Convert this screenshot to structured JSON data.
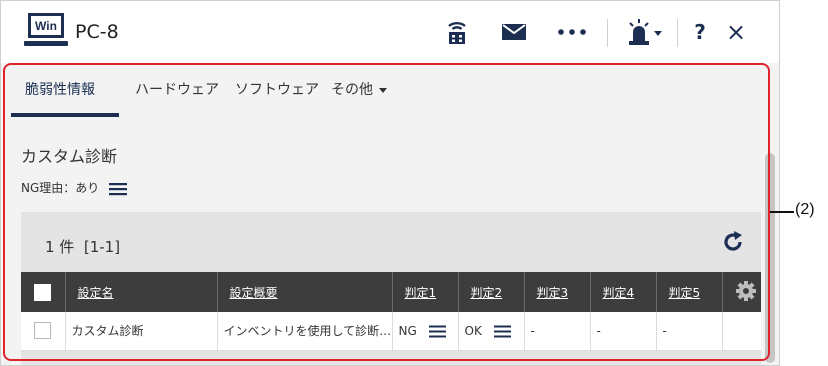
{
  "window": {
    "icon_text": "Win",
    "title": "PC-8"
  },
  "toolbar": {
    "network_icon": "antenna-icon",
    "mail_icon": "mail-icon",
    "more_icon": "more-icon",
    "alert_icon": "alert-light-icon",
    "help_label": "?",
    "close_label": "×"
  },
  "tabs": [
    {
      "label": "脆弱性情報",
      "active": true
    },
    {
      "label": "ハードウェア",
      "active": false
    },
    {
      "label": "ソフトウェア",
      "active": false
    },
    {
      "label": "その他",
      "active": false
    }
  ],
  "section": {
    "title": "カスタム診断",
    "ng_reason": "NG理由：あり"
  },
  "results": {
    "count": "1 件",
    "range": "[1-1]"
  },
  "table": {
    "columns": [
      "設定名",
      "設定概要",
      "判定1",
      "判定2",
      "判定3",
      "判定4",
      "判定5"
    ],
    "rows": [
      {
        "name": "カスタム診断",
        "summary": "インベントリを使用して診断…",
        "j1": "NG",
        "j2": "OK",
        "j3": "-",
        "j4": "-",
        "j5": "-"
      }
    ]
  },
  "annotation": {
    "label": "(2)",
    "color": "#e0242b"
  }
}
